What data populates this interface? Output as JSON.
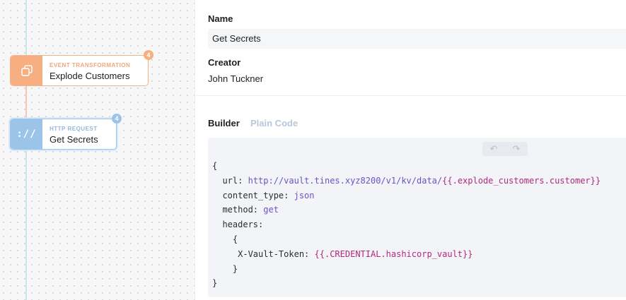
{
  "canvas": {
    "nodes": [
      {
        "kind": "EVENT TRANSFORMATION",
        "title": "Explode Customers",
        "badge": "4",
        "icon": "copy-icon"
      },
      {
        "kind": "HTTP REQUEST",
        "title": "Get Secrets",
        "badge": "4",
        "icon": ":/"
      }
    ]
  },
  "panel": {
    "name_label": "Name",
    "name_value": "Get Secrets",
    "creator_label": "Creator",
    "creator_value": "John Tuckner",
    "tabs": {
      "builder": "Builder",
      "plain_code": "Plain Code"
    },
    "toolbar": {
      "undo_icon": "undo-icon",
      "redo_icon": "redo-icon"
    },
    "code": {
      "open_brace": "{",
      "url_key": "url:",
      "url_value": "http://vault.tines.xyz8200/v1/kv/data/",
      "url_template": "{{.explode_customers.customer}}",
      "content_type_key": "content_type:",
      "content_type_value": "json",
      "method_key": "method:",
      "method_value": "get",
      "headers_key": "headers:",
      "inner_open": "{",
      "token_key": "X-Vault-Token:",
      "token_value": "{{.CREDENTIAL.hashicorp_vault}}",
      "inner_close": "}",
      "close_brace": "}"
    }
  },
  "colors": {
    "event_accent": "#f7ae80",
    "http_accent": "#9cc4e8",
    "code_value": "#6b52c8",
    "code_template": "#b0297d"
  }
}
